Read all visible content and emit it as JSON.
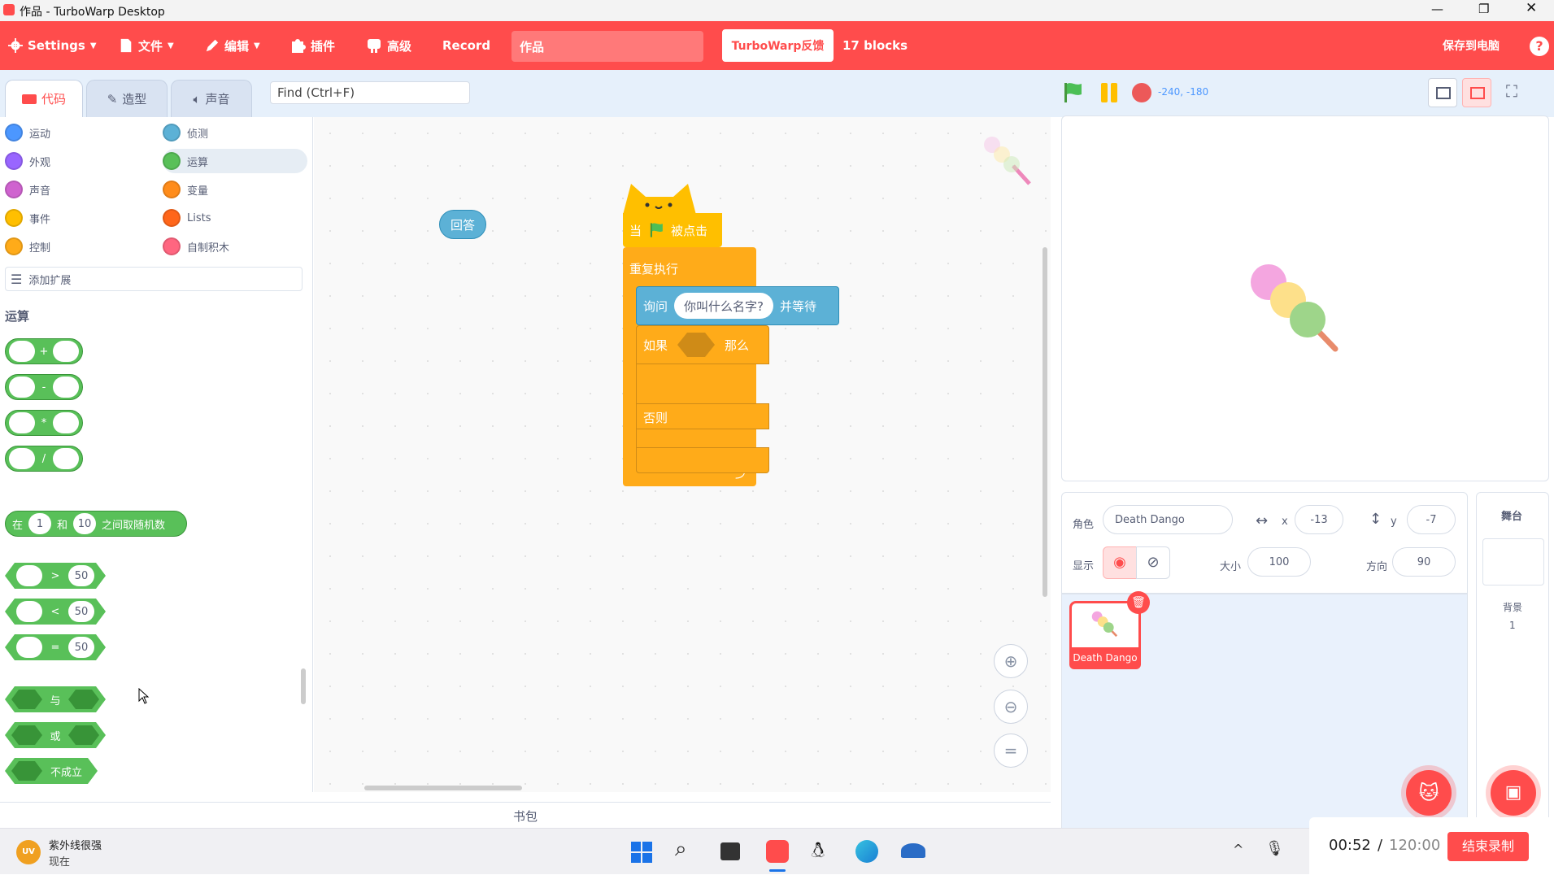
{
  "window": {
    "title": "作品 - TurboWarp Desktop"
  },
  "menu": {
    "settings": "Settings",
    "file": "文件",
    "edit": "编辑",
    "addons": "插件",
    "advanced": "高级",
    "record": "Record",
    "project_title": "作品",
    "feedback": "TurboWarp反馈",
    "blocks_count": "17 blocks",
    "save": "保存到电脑"
  },
  "tabs": {
    "code": "代码",
    "costumes": "造型",
    "sounds": "声音"
  },
  "find": {
    "placeholder": "Find (Ctrl+F)"
  },
  "stage_controls": {
    "coords": "-240, -180"
  },
  "categories": [
    {
      "label": "运动",
      "color": "#4c97ff"
    },
    {
      "label": "侦测",
      "color": "#5cb1d6"
    },
    {
      "label": "外观",
      "color": "#9966ff"
    },
    {
      "label": "运算",
      "color": "#59c059"
    },
    {
      "label": "声音",
      "color": "#cf63cf"
    },
    {
      "label": "变量",
      "color": "#ff8c1a"
    },
    {
      "label": "事件",
      "color": "#ffbf00"
    },
    {
      "label": "Lists",
      "color": "#ff661a"
    },
    {
      "label": "控制",
      "color": "#ffab19"
    },
    {
      "label": "自制积木",
      "color": "#ff6680"
    }
  ],
  "add_extension": "添加扩展",
  "palette": {
    "heading": "运算",
    "arith_ops": [
      "+",
      "-",
      "*",
      "/"
    ],
    "random": {
      "prefix": "在",
      "a": "1",
      "mid": "和",
      "b": "10",
      "suffix": "之间取随机数"
    },
    "compare": [
      {
        "op": ">",
        "v": "50"
      },
      {
        "op": "<",
        "v": "50"
      },
      {
        "op": "=",
        "v": "50"
      }
    ],
    "bool": {
      "and": "与",
      "or": "或",
      "not": "不成立"
    }
  },
  "workspace": {
    "answer_reporter": "回答",
    "hat": {
      "when": "当",
      "clicked": "被点击"
    },
    "forever": "重复执行",
    "ask": {
      "label": "询问",
      "question": "你叫什么名字?",
      "wait": "并等待"
    },
    "if": {
      "label": "如果",
      "then": "那么"
    },
    "else": "否则",
    "backpack": "书包"
  },
  "sprite": {
    "label_sprite": "角色",
    "name": "Death Dango",
    "x_label": "x",
    "x": "-13",
    "y_label": "y",
    "y": "-7",
    "show_label": "显示",
    "size_label": "大小",
    "size": "100",
    "direction_label": "方向",
    "direction": "90",
    "thumb_name": "Death Dango"
  },
  "stage_panel": {
    "title": "舞台",
    "backdrops_label": "背景",
    "backdrops_count": "1"
  },
  "taskbar": {
    "user_name": "紫外线很强",
    "user_status": "现在",
    "avatar_text": "UV",
    "timer_elapsed": "00:52",
    "timer_sep": "/",
    "timer_total": "120:00",
    "end_record": "结束录制"
  },
  "colors": {
    "brand": "#ff4c4c",
    "operators": "#59c059",
    "control": "#ffab19",
    "events": "#ffbf00",
    "sensing": "#5cb1d6"
  }
}
